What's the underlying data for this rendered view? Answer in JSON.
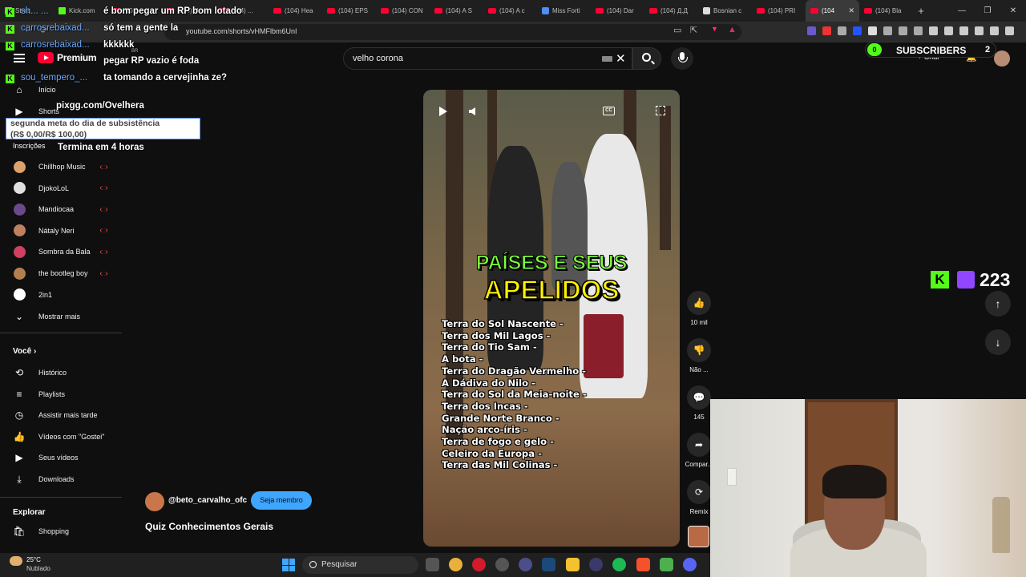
{
  "browser": {
    "tabs": [
      {
        "title": "Strea",
        "kind": "k"
      },
      {
        "title": "Kick.com",
        "kind": "k"
      },
      {
        "title": "(104) ...",
        "kind": "yt"
      },
      {
        "title": "(104) Nc...",
        "kind": "yt"
      },
      {
        "title": "(104) ...",
        "kind": "yt"
      },
      {
        "title": "(104) Hea",
        "kind": "yt"
      },
      {
        "title": "(104) EPS",
        "kind": "yt"
      },
      {
        "title": "(104) CON",
        "kind": "yt"
      },
      {
        "title": "(104) A S",
        "kind": "yt"
      },
      {
        "title": "(104) A c",
        "kind": "yt"
      },
      {
        "title": "Miss Forti",
        "kind": "g"
      },
      {
        "title": "(104) Dar",
        "kind": "yt"
      },
      {
        "title": "(104) Д.Д",
        "kind": "yt"
      },
      {
        "title": "Bosnian c",
        "kind": "w"
      },
      {
        "title": "(104) PRI",
        "kind": "yt"
      },
      {
        "title": "(104",
        "kind": "yt",
        "active": true
      },
      {
        "title": "(104) Bla",
        "kind": "yt"
      }
    ],
    "new_tab": "+",
    "url": "youtube.com/shorts/vHMFlbm6UnI",
    "window_controls": [
      "—",
      "❐",
      "✕"
    ]
  },
  "youtube": {
    "logo": "Premium",
    "logo_region": "BR",
    "search_value": "velho corona",
    "create_label": "Criar",
    "notification_count": "9+",
    "sidebar": {
      "main": [
        {
          "label": "Início",
          "icon": "home-icon"
        },
        {
          "label": "Shorts",
          "icon": "shorts-icon"
        }
      ],
      "subscriptions_title": "Inscrições",
      "subscriptions": [
        {
          "name": "Chillhop Music",
          "color": "#d9a36b"
        },
        {
          "name": "DjokoLoL",
          "color": "#e0e0e0"
        },
        {
          "name": "Mandiocaa",
          "color": "#6a4a8a"
        },
        {
          "name": "Nátaly Neri",
          "color": "#c08060"
        },
        {
          "name": "Sombra da Bala",
          "color": "#d04060"
        },
        {
          "name": "the bootleg boy",
          "color": "#b08050"
        },
        {
          "name": "2in1",
          "color": "#ffffff"
        }
      ],
      "show_more": "Mostrar mais",
      "you_title": "Você",
      "you_items": [
        {
          "label": "Histórico",
          "icon": "history-icon"
        },
        {
          "label": "Playlists",
          "icon": "playlists-icon"
        },
        {
          "label": "Assistir mais tarde",
          "icon": "watch-later-icon"
        },
        {
          "label": "Vídeos com \"Gostei\"",
          "icon": "liked-icon"
        },
        {
          "label": "Seus vídeos",
          "icon": "your-videos-icon"
        },
        {
          "label": "Downloads",
          "icon": "downloads-icon"
        }
      ],
      "explore_title": "Explorar",
      "explore_items": [
        {
          "label": "Shopping",
          "icon": "shopping-icon"
        }
      ]
    },
    "short": {
      "title_line1": "PAÍSES E SEUS",
      "title_line2": "APELIDOS",
      "list": [
        "Terra do Sol Nascente -",
        "Terra dos Mil Lagos -",
        "Terra do Tio Sam -",
        "A bota -",
        "Terra do Dragão Vermelho -",
        "A Dádiva do Nilo -",
        "Terra do Sol da Meia-noite -",
        "Terra dos Incas -",
        "Grande Norte Branco -",
        "Nação arco-íris -",
        "Terra de fogo e gelo -",
        "Celeiro da Europa -",
        "Terra das Mil Colinas -"
      ],
      "cc_label": "CC",
      "channel": "@beto_carvalho_ofc",
      "join_label": "Seja membro",
      "video_title": "Quiz Conhecimentos Gerais"
    },
    "actions": [
      {
        "icon": "like-icon",
        "glyph": "👍",
        "label": "10 mil"
      },
      {
        "icon": "dislike-icon",
        "glyph": "👎",
        "label": "Não ..."
      },
      {
        "icon": "comments-icon",
        "glyph": "💬",
        "label": "145"
      },
      {
        "icon": "share-icon",
        "glyph": "➦",
        "label": "Compar..."
      },
      {
        "icon": "remix-icon",
        "glyph": "⟳",
        "label": "Remix"
      }
    ]
  },
  "overlay": {
    "chat": [
      {
        "user": "sh... ...",
        "text": "é bom pegar um RP bom lotado"
      },
      {
        "user": "carrosrebaixad...",
        "text": "só tem a gente la"
      },
      {
        "user": "carrosrebaixad...",
        "text": "kkkkkk"
      },
      {
        "user": "",
        "text": "pegar RP vazio é foda"
      },
      {
        "user": "sou_tempero_...",
        "text": "ta tomando a cervejinha ze?"
      }
    ],
    "pix": "pixgg.com/Ovelhera",
    "goal_line1": "segunda meta do dia de subsistência",
    "goal_line2": "(R$ 0,00/R$ 100,00)",
    "goal_end": "Termina em 4 horas",
    "sub_badge": "0",
    "sub_label": "SUBSCRIBERS",
    "sub_value": "2",
    "viewer_k": "K",
    "viewer_count": "223"
  },
  "taskbar": {
    "temp": "25°C",
    "weather": "Nublado",
    "search_placeholder": "Pesquisar"
  }
}
